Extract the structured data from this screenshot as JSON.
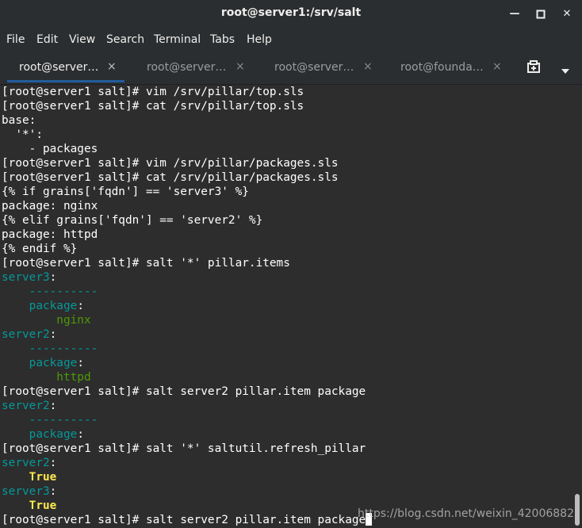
{
  "window": {
    "title": "root@server1:/srv/salt",
    "minimize_label": "—",
    "maximize_label": "□",
    "close_label": "✕"
  },
  "menu": [
    "File",
    "Edit",
    "View",
    "Search",
    "Terminal",
    "Tabs",
    "Help"
  ],
  "tabs": [
    {
      "label": "root@server…",
      "active": true
    },
    {
      "label": "root@server…",
      "active": false
    },
    {
      "label": "root@server…",
      "active": false
    },
    {
      "label": "root@founda…",
      "active": false
    }
  ],
  "tab_close_glyph": "×",
  "terminal": {
    "lines": [
      [
        {
          "t": "[root@server1 salt]# vim /srv/pillar/top.sls",
          "c": ""
        }
      ],
      [
        {
          "t": "[root@server1 salt]# cat /srv/pillar/top.sls",
          "c": ""
        }
      ],
      [
        {
          "t": "base:",
          "c": ""
        }
      ],
      [
        {
          "t": "  '*':",
          "c": ""
        }
      ],
      [
        {
          "t": "    - packages",
          "c": ""
        }
      ],
      [
        {
          "t": "[root@server1 salt]# vim /srv/pillar/packages.sls",
          "c": ""
        }
      ],
      [
        {
          "t": "[root@server1 salt]# cat /srv/pillar/packages.sls",
          "c": ""
        }
      ],
      [
        {
          "t": "{% if grains['fqdn'] == 'server3' %}",
          "c": ""
        }
      ],
      [
        {
          "t": "package: nginx",
          "c": ""
        }
      ],
      [
        {
          "t": "{% elif grains['fqdn'] == 'server2' %}",
          "c": ""
        }
      ],
      [
        {
          "t": "package: httpd",
          "c": ""
        }
      ],
      [
        {
          "t": "{% endif %}",
          "c": ""
        }
      ],
      [
        {
          "t": "[root@server1 salt]# salt '*' pillar.items",
          "c": ""
        }
      ],
      [
        {
          "t": "server3",
          "c": "cyan"
        },
        {
          "t": ":",
          "c": ""
        }
      ],
      [
        {
          "t": "    ----------",
          "c": "cyan"
        }
      ],
      [
        {
          "t": "    package",
          "c": "cyan"
        },
        {
          "t": ":",
          "c": ""
        }
      ],
      [
        {
          "t": "        nginx",
          "c": "green"
        }
      ],
      [
        {
          "t": "server2",
          "c": "cyan"
        },
        {
          "t": ":",
          "c": ""
        }
      ],
      [
        {
          "t": "    ----------",
          "c": "cyan"
        }
      ],
      [
        {
          "t": "    package",
          "c": "cyan"
        },
        {
          "t": ":",
          "c": ""
        }
      ],
      [
        {
          "t": "        httpd",
          "c": "green"
        }
      ],
      [
        {
          "t": "[root@server1 salt]# salt server2 pillar.item package",
          "c": ""
        }
      ],
      [
        {
          "t": "server2",
          "c": "cyan"
        },
        {
          "t": ":",
          "c": ""
        }
      ],
      [
        {
          "t": "    ----------",
          "c": "cyan"
        }
      ],
      [
        {
          "t": "    package",
          "c": "cyan"
        },
        {
          "t": ":",
          "c": ""
        }
      ],
      [
        {
          "t": "[root@server1 salt]# salt '*' saltutil.refresh_pillar",
          "c": ""
        }
      ],
      [
        {
          "t": "server2",
          "c": "cyan"
        },
        {
          "t": ":",
          "c": ""
        }
      ],
      [
        {
          "t": "    True",
          "c": "yellow"
        }
      ],
      [
        {
          "t": "server3",
          "c": "cyan"
        },
        {
          "t": ":",
          "c": ""
        }
      ],
      [
        {
          "t": "    True",
          "c": "yellow"
        }
      ],
      [
        {
          "t": "[root@server1 salt]# salt server2 pillar.item package",
          "c": ""
        }
      ]
    ]
  },
  "watermark": "https://blog.csdn.net/weixin_42006882",
  "colors": {
    "background": "#2d2d2d",
    "key_cyan": "#06989a",
    "value_green": "#4e9a06",
    "bool_yellow": "#fce94f",
    "tab_accent": "#215d9c"
  },
  "icons": {
    "new_tab": "new-tab-icon",
    "tab_menu": "chevron-down-icon"
  }
}
